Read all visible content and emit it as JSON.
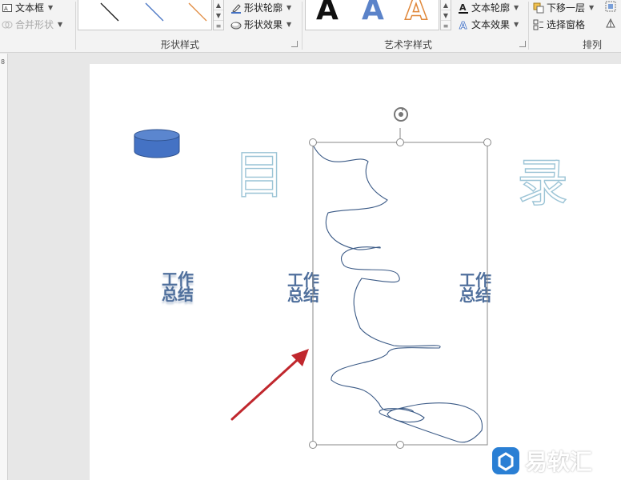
{
  "ribbon": {
    "text_box": "文本框",
    "merge_shapes": "合并形状",
    "shape_outline": "形状轮廓",
    "shape_effects": "形状效果",
    "shape_styles_group": "形状样式",
    "wordart_letter": "A",
    "text_outline": "文本轮廓",
    "text_effects": "文本效果",
    "wordart_styles_group": "艺术字样式",
    "send_backward": "下移一层",
    "selection_pane": "选择窗格",
    "arrange_group": "排列"
  },
  "ruler": {
    "mark": "8"
  },
  "slide": {
    "title_char_left": "目",
    "title_char_right": "录",
    "items": [
      {
        "line1": "工作",
        "line2": "总结"
      },
      {
        "line1": "工作",
        "line2": "总结"
      },
      {
        "line1": "工作",
        "line2": "总结"
      }
    ]
  },
  "watermark": {
    "text": "易软汇"
  },
  "colors": {
    "arrow": "#c0272d",
    "cylinder": "#4472c4",
    "wordart_blue": "#4f6f9c",
    "hatch_blue": "#9cc4d6",
    "freeform_stroke": "#3b5a86"
  }
}
